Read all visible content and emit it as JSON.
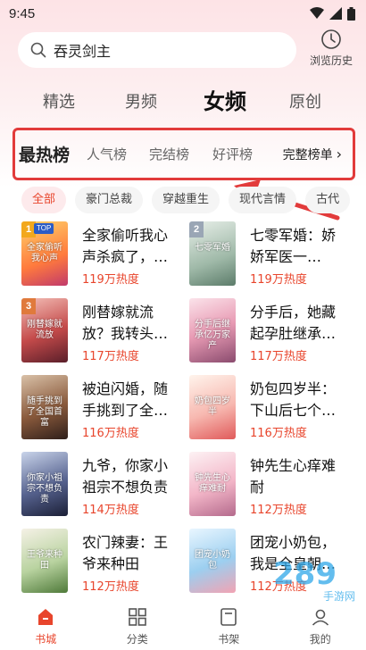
{
  "status": {
    "time": "9:45"
  },
  "search": {
    "query": "吞灵剑主"
  },
  "history": {
    "label": "浏览历史"
  },
  "channels": [
    {
      "label": "精选"
    },
    {
      "label": "男频"
    },
    {
      "label": "女频"
    },
    {
      "label": "原创"
    }
  ],
  "active_channel": "女频",
  "ranks": {
    "items": [
      {
        "label": "最热榜"
      },
      {
        "label": "人气榜"
      },
      {
        "label": "完结榜"
      },
      {
        "label": "好评榜"
      }
    ],
    "full_list": "完整榜单",
    "full_chevron": "›"
  },
  "chips": [
    {
      "label": "全部"
    },
    {
      "label": "豪门总裁"
    },
    {
      "label": "穿越重生"
    },
    {
      "label": "现代言情"
    },
    {
      "label": "古代"
    }
  ],
  "books": [
    {
      "title": "全家偷听我心声杀疯了，我...",
      "heat": "119万热度",
      "cover_text": "全家偷听我心声",
      "rank": "1",
      "badge": "TOP"
    },
    {
      "title": "七零军婚：娇娇军医一哭，...",
      "heat": "119万热度",
      "cover_text": "七零军婚",
      "rank": "2",
      "badge": ""
    },
    {
      "title": "刚替嫁就流放？我转头搬...",
      "heat": "117万热度",
      "cover_text": "刚替嫁就流放",
      "rank": "3",
      "badge": ""
    },
    {
      "title": "分手后，她藏起孕肚继承亿...",
      "heat": "117万热度",
      "cover_text": "分手后继承亿万家产",
      "rank": "",
      "badge": ""
    },
    {
      "title": "被迫闪婚，随手挑到了全国...",
      "heat": "116万热度",
      "cover_text": "随手挑到了全国首富",
      "rank": "",
      "badge": ""
    },
    {
      "title": "奶包四岁半：下山后七个哥...",
      "heat": "116万热度",
      "cover_text": "奶包四岁半",
      "rank": "",
      "badge": ""
    },
    {
      "title": "九爷，你家小祖宗不想负责",
      "heat": "114万热度",
      "cover_text": "你家小祖宗不想负责",
      "rank": "",
      "badge": ""
    },
    {
      "title": "钟先生心痒难耐",
      "heat": "112万热度",
      "cover_text": "钟先生心痒难耐",
      "rank": "",
      "badge": ""
    },
    {
      "title": "农门辣妻：王爷来种田",
      "heat": "112万热度",
      "cover_text": "王爷来种田",
      "rank": "",
      "badge": ""
    },
    {
      "title": "团宠小奶包，我是全皇朝最...",
      "heat": "112万热度",
      "cover_text": "团宠小奶包",
      "rank": "",
      "badge": ""
    }
  ],
  "nav": [
    {
      "label": "书城",
      "icon": "home-icon"
    },
    {
      "label": "分类",
      "icon": "grid-icon"
    },
    {
      "label": "书架",
      "icon": "bookshelf-icon"
    },
    {
      "label": "我的",
      "icon": "user-icon"
    }
  ],
  "watermark": {
    "text": "289",
    "suffix": "手游网"
  },
  "colors": {
    "accent": "#e8452c",
    "highlight_box": "#e23b3b",
    "header_bg": "#fde3e6"
  }
}
